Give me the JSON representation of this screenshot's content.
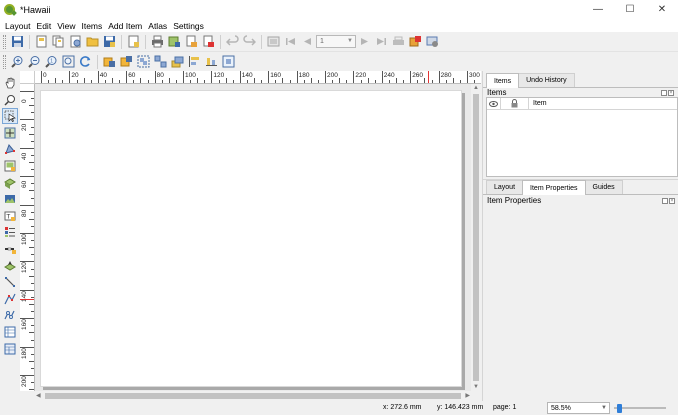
{
  "window": {
    "title": "*Hawaii",
    "minimize_label": "—",
    "maximize_label": "☐",
    "close_label": "✕"
  },
  "menu": [
    "Layout",
    "Edit",
    "View",
    "Items",
    "Add Item",
    "Atlas",
    "Settings"
  ],
  "toolbar": {
    "atlas_page_value": "1"
  },
  "ruler": {
    "h_labels": [
      "0",
      "20",
      "40",
      "60",
      "80",
      "100",
      "120",
      "140",
      "160",
      "180",
      "200",
      "220",
      "240",
      "260",
      "280",
      "300"
    ],
    "v_labels": [
      "0",
      "20",
      "40",
      "60",
      "80",
      "100",
      "120",
      "140",
      "160",
      "180",
      "200"
    ]
  },
  "right_panel": {
    "top_tabs": [
      "Items",
      "Undo History"
    ],
    "items_title": "Items",
    "items_column_item": "Item",
    "bottom_tabs": [
      "Layout",
      "Item Properties",
      "Guides"
    ],
    "properties_title": "Item Properties"
  },
  "status": {
    "x": "x: 272.6 mm",
    "y": "y: 146.423 mm",
    "page": "page: 1",
    "zoom": "58.5%"
  },
  "colors": {
    "accent": "#2f7ed8",
    "qgis_green": "#589632",
    "ruler_marker": "#e33333"
  },
  "icons": {
    "toolbar1": [
      "save-icon",
      "new-layout-icon",
      "duplicate-icon",
      "layout-manager-icon",
      "open-template-icon",
      "save-template-icon",
      "page-setup-icon",
      "print-icon",
      "export-image-icon",
      "export-svg-icon",
      "export-pdf-icon",
      "undo-icon",
      "redo-icon",
      "atlas-preview-icon",
      "first-feature-icon",
      "previous-feature-icon",
      "next-feature-icon",
      "last-feature-icon",
      "print-atlas-icon",
      "export-atlas-icon",
      "atlas-settings-icon"
    ],
    "toolbar2": [
      "zoom-in-icon",
      "zoom-out-icon",
      "zoom-actual-icon",
      "zoom-full-icon",
      "refresh-icon",
      "lock-items-icon",
      "unlock-items-icon",
      "group-icon",
      "ungroup-icon",
      "raise-icon",
      "align-left-icon",
      "distribute-icon",
      "resize-icon"
    ],
    "left": [
      "pan-icon",
      "zoom-tool-icon",
      "select-icon",
      "move-content-icon",
      "edit-nodes-icon",
      "add-map-icon",
      "add-3d-map-icon",
      "add-picture-icon",
      "add-label-icon",
      "add-legend-icon",
      "add-scalebar-icon",
      "add-north-arrow-icon",
      "add-shape-icon",
      "add-marker-icon",
      "add-arrow-icon",
      "add-node-item-icon",
      "add-html-icon",
      "add-attribute-table-icon",
      "add-fixed-table-icon"
    ]
  }
}
